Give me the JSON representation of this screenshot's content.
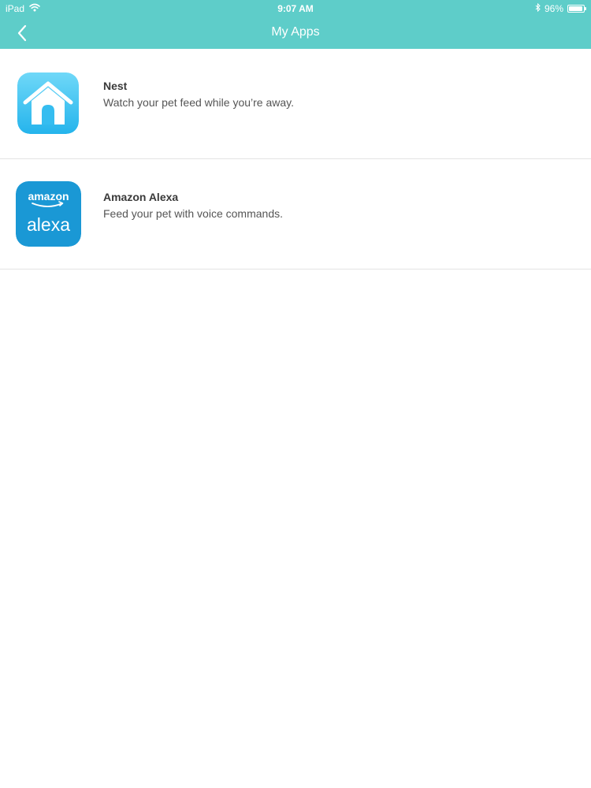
{
  "status_bar": {
    "device": "iPad",
    "time": "9:07 AM",
    "battery": "96%",
    "battery_level": 0.96
  },
  "nav": {
    "title": "My Apps",
    "back_icon": "chevron-left-icon"
  },
  "apps": [
    {
      "name": "Nest",
      "description": "Watch your pet feed while you’re away.",
      "icon": "nest-home-icon"
    },
    {
      "name": "Amazon Alexa",
      "description": "Feed your pet with voice commands.",
      "icon": "amazon-alexa-logo",
      "logo_text_top": "amazon",
      "logo_text_bottom": "alexa"
    }
  ],
  "colors": {
    "header": "#5ecdc9",
    "nest_gradient_top": "#6fd8f8",
    "nest_gradient_bottom": "#25b4ec",
    "alexa_blue": "#1a98d5",
    "divider": "#e3e3e3"
  }
}
